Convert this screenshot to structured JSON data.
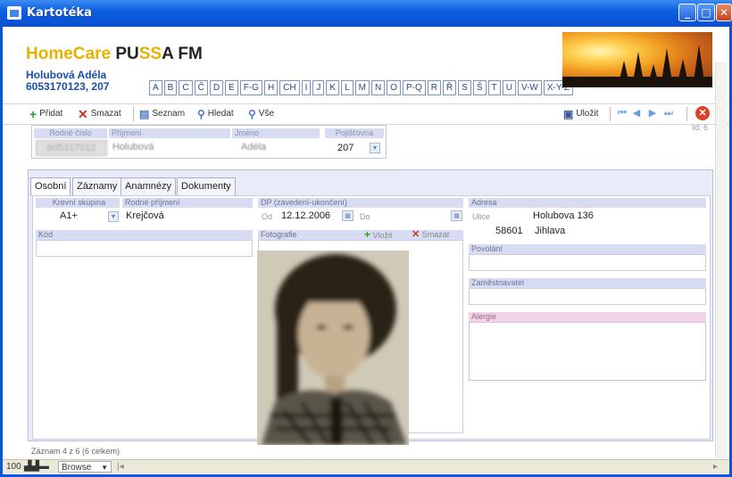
{
  "window": {
    "title": "Kartotéka"
  },
  "header": {
    "logo_part1": "HomeCare",
    "logo_part2": "PU",
    "logo_part3": "SS",
    "logo_part4": "A FM",
    "patient_name": "Holubová Adéla",
    "patient_id": "6053170123, 207"
  },
  "alphabet": [
    "A",
    "B",
    "C",
    "Č",
    "D",
    "E",
    "F-G",
    "H",
    "CH",
    "I",
    "J",
    "K",
    "L",
    "M",
    "N",
    "O",
    "P-Q",
    "R",
    "Ř",
    "S",
    "Š",
    "T",
    "U",
    "V-W",
    "X-Y-Z"
  ],
  "toolbar": {
    "add": "Přidat",
    "delete": "Smazat",
    "list": "Seznam",
    "search": "Hledat",
    "all": "Vše",
    "save": "Uložit"
  },
  "record_header": {
    "id_label": "Id: 6",
    "rodne_cislo_label": "Rodné číslo",
    "rodne_cislo_value": "605317012",
    "prijmeni_label": "Příjmení",
    "prijmeni_value": "Holubová",
    "jmeno_label": "Jméno",
    "jmeno_value": "Adéla",
    "pojistovna_label": "Pojišťovna",
    "pojistovna_value": "207"
  },
  "tabs": [
    "Osobní",
    "Záznamy",
    "Anamnézy",
    "Dokumenty"
  ],
  "osobni": {
    "krevni_skupina_label": "Krevní skupina",
    "krevni_skupina_value": "A1+",
    "rodne_prijmeni_label": "Rodné příjmení",
    "rodne_prijmeni_value": "Krejčová",
    "dp_label": "DP (zavedení-ukončení)",
    "od_label": "Od",
    "od_value": "12.12.2006",
    "do_label": "Do",
    "adresa_label": "Adresa",
    "ulice_label": "Ulice",
    "ulice_value": "Holubova 136",
    "psc_value": "58601",
    "mesto_value": "Jihlava",
    "kod_label": "Kód",
    "fotografie_label": "Fotografie",
    "foto_vlozit": "Vložit",
    "foto_smazat": "Smazat",
    "povolani_label": "Povolání",
    "zamestnavatel_label": "Zaměstnavatel",
    "alergie_label": "Alergie"
  },
  "status": "Záznam 4 z 6 (6 celkem)",
  "bottom_bar": {
    "zoom": "100",
    "mode": "Browse"
  }
}
